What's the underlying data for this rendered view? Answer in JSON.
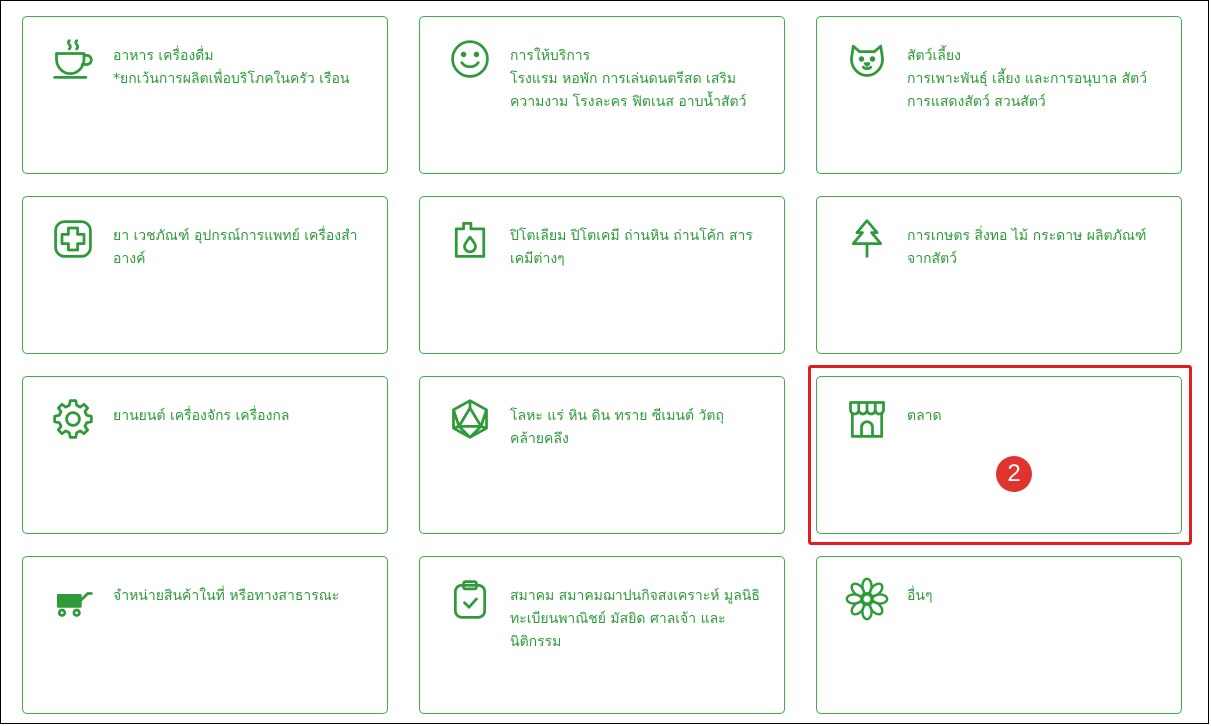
{
  "categories": [
    {
      "icon": "coffee-cup-icon",
      "title": "อาหาร เครื่องดื่ม",
      "desc": "*ยกเว้นการผลิตเพื่อบริโภคในครัว เรือน"
    },
    {
      "icon": "smiley-face-icon",
      "title": "การให้บริการ",
      "desc": "โรงแรม หอพัก การเล่นดนตรีสด เสริมความงาม โรงละคร ฟิตเนส อาบน้ำสัตว์"
    },
    {
      "icon": "dog-face-icon",
      "title": "สัตว์เลี้ยง",
      "desc": "การเพาะพันธุ์ เลี้ยง และการอนุบาล สัตว์ การแสดงสัตว์ สวนสัตว์"
    },
    {
      "icon": "medical-cross-icon",
      "title": "ยา เวชภัณฑ์ อุปกรณ์การแพทย์ เครื่องสำอางค์",
      "desc": ""
    },
    {
      "icon": "oil-can-drop-icon",
      "title": "ปิโตเลียม ปิโตเคมี ถ่านหิน ถ่านโค้ก สารเคมีต่างๆ",
      "desc": ""
    },
    {
      "icon": "tree-icon",
      "title": "การเกษตร สิ่งทอ ไม้ กระดาษ ผลิตภัณฑ์จากสัตว์",
      "desc": ""
    },
    {
      "icon": "gear-icon",
      "title": "ยานยนต์ เครื่องจักร เครื่องกล",
      "desc": ""
    },
    {
      "icon": "polyhedron-gem-icon",
      "title": "โลหะ แร่ หิน ดิน ทราย ซีเมนต์ วัตถุคล้ายคลึง",
      "desc": ""
    },
    {
      "icon": "market-store-icon",
      "title": "ตลาด",
      "desc": ""
    },
    {
      "icon": "vendor-cart-icon",
      "title": "จำหน่ายสินค้าในที่ หรือทางสาธารณะ",
      "desc": ""
    },
    {
      "icon": "clipboard-check-icon",
      "title": "สมาคม สมาคมฌาปนกิจสงเคราะห์ มูลนิธิ ทะเบียนพาณิชย์ มัสยิด ศาลเจ้า และนิติกรรม",
      "desc": ""
    },
    {
      "icon": "flower-icon",
      "title": "อื่นๆ",
      "desc": ""
    }
  ],
  "annotation": {
    "step_number": "2"
  },
  "colors": {
    "accent": "#3fae49",
    "text": "#2e9a3a",
    "highlight": "#e31d1d",
    "badge": "#e0322e"
  }
}
